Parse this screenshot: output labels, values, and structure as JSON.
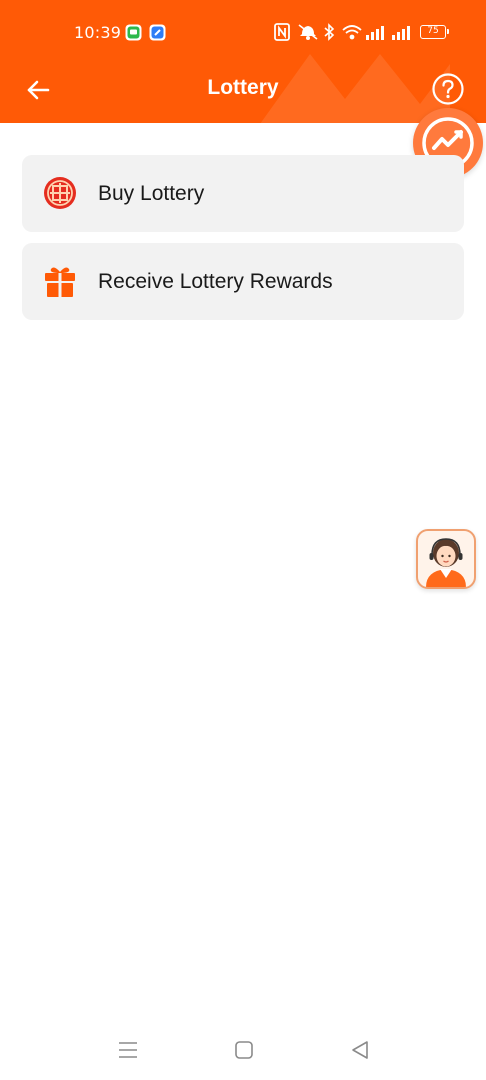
{
  "status_bar": {
    "time": "10:39",
    "battery": "75",
    "icons": [
      "messages-app-icon",
      "blue-app-icon",
      "nfc-icon",
      "mute-icon",
      "bluetooth-icon",
      "wifi-icon",
      "signal-icon",
      "signal-icon",
      "battery-icon"
    ]
  },
  "header": {
    "title": "Lottery",
    "back_icon": "arrow-left-icon",
    "help_icon": "question-circle-icon",
    "background_color": "#ff5a06"
  },
  "menu": {
    "items": [
      {
        "label": "Buy Lottery",
        "icon": "lottery-coin-icon"
      },
      {
        "label": "Receive Lottery Rewards",
        "icon": "gift-icon"
      }
    ]
  },
  "floating": {
    "badge_icon": "chart-check-icon",
    "support_icon": "customer-service-avatar-icon"
  },
  "navigation_bar": {
    "icons": [
      "menu-lines-icon",
      "home-square-icon",
      "back-triangle-icon"
    ]
  },
  "colors": {
    "accent": "#ff5a06",
    "card_background": "#f2f2f2",
    "text": "#1a1a1a"
  }
}
